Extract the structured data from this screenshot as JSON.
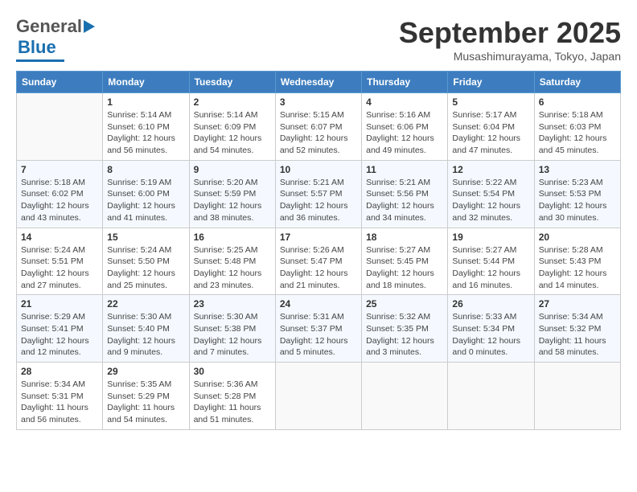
{
  "header": {
    "logo_general": "General",
    "logo_blue": "Blue",
    "month_title": "September 2025",
    "location": "Musashimurayama, Tokyo, Japan"
  },
  "weekdays": [
    "Sunday",
    "Monday",
    "Tuesday",
    "Wednesday",
    "Thursday",
    "Friday",
    "Saturday"
  ],
  "weeks": [
    [
      {
        "day": "",
        "info": ""
      },
      {
        "day": "1",
        "info": "Sunrise: 5:14 AM\nSunset: 6:10 PM\nDaylight: 12 hours\nand 56 minutes."
      },
      {
        "day": "2",
        "info": "Sunrise: 5:14 AM\nSunset: 6:09 PM\nDaylight: 12 hours\nand 54 minutes."
      },
      {
        "day": "3",
        "info": "Sunrise: 5:15 AM\nSunset: 6:07 PM\nDaylight: 12 hours\nand 52 minutes."
      },
      {
        "day": "4",
        "info": "Sunrise: 5:16 AM\nSunset: 6:06 PM\nDaylight: 12 hours\nand 49 minutes."
      },
      {
        "day": "5",
        "info": "Sunrise: 5:17 AM\nSunset: 6:04 PM\nDaylight: 12 hours\nand 47 minutes."
      },
      {
        "day": "6",
        "info": "Sunrise: 5:18 AM\nSunset: 6:03 PM\nDaylight: 12 hours\nand 45 minutes."
      }
    ],
    [
      {
        "day": "7",
        "info": "Sunrise: 5:18 AM\nSunset: 6:02 PM\nDaylight: 12 hours\nand 43 minutes."
      },
      {
        "day": "8",
        "info": "Sunrise: 5:19 AM\nSunset: 6:00 PM\nDaylight: 12 hours\nand 41 minutes."
      },
      {
        "day": "9",
        "info": "Sunrise: 5:20 AM\nSunset: 5:59 PM\nDaylight: 12 hours\nand 38 minutes."
      },
      {
        "day": "10",
        "info": "Sunrise: 5:21 AM\nSunset: 5:57 PM\nDaylight: 12 hours\nand 36 minutes."
      },
      {
        "day": "11",
        "info": "Sunrise: 5:21 AM\nSunset: 5:56 PM\nDaylight: 12 hours\nand 34 minutes."
      },
      {
        "day": "12",
        "info": "Sunrise: 5:22 AM\nSunset: 5:54 PM\nDaylight: 12 hours\nand 32 minutes."
      },
      {
        "day": "13",
        "info": "Sunrise: 5:23 AM\nSunset: 5:53 PM\nDaylight: 12 hours\nand 30 minutes."
      }
    ],
    [
      {
        "day": "14",
        "info": "Sunrise: 5:24 AM\nSunset: 5:51 PM\nDaylight: 12 hours\nand 27 minutes."
      },
      {
        "day": "15",
        "info": "Sunrise: 5:24 AM\nSunset: 5:50 PM\nDaylight: 12 hours\nand 25 minutes."
      },
      {
        "day": "16",
        "info": "Sunrise: 5:25 AM\nSunset: 5:48 PM\nDaylight: 12 hours\nand 23 minutes."
      },
      {
        "day": "17",
        "info": "Sunrise: 5:26 AM\nSunset: 5:47 PM\nDaylight: 12 hours\nand 21 minutes."
      },
      {
        "day": "18",
        "info": "Sunrise: 5:27 AM\nSunset: 5:45 PM\nDaylight: 12 hours\nand 18 minutes."
      },
      {
        "day": "19",
        "info": "Sunrise: 5:27 AM\nSunset: 5:44 PM\nDaylight: 12 hours\nand 16 minutes."
      },
      {
        "day": "20",
        "info": "Sunrise: 5:28 AM\nSunset: 5:43 PM\nDaylight: 12 hours\nand 14 minutes."
      }
    ],
    [
      {
        "day": "21",
        "info": "Sunrise: 5:29 AM\nSunset: 5:41 PM\nDaylight: 12 hours\nand 12 minutes."
      },
      {
        "day": "22",
        "info": "Sunrise: 5:30 AM\nSunset: 5:40 PM\nDaylight: 12 hours\nand 9 minutes."
      },
      {
        "day": "23",
        "info": "Sunrise: 5:30 AM\nSunset: 5:38 PM\nDaylight: 12 hours\nand 7 minutes."
      },
      {
        "day": "24",
        "info": "Sunrise: 5:31 AM\nSunset: 5:37 PM\nDaylight: 12 hours\nand 5 minutes."
      },
      {
        "day": "25",
        "info": "Sunrise: 5:32 AM\nSunset: 5:35 PM\nDaylight: 12 hours\nand 3 minutes."
      },
      {
        "day": "26",
        "info": "Sunrise: 5:33 AM\nSunset: 5:34 PM\nDaylight: 12 hours\nand 0 minutes."
      },
      {
        "day": "27",
        "info": "Sunrise: 5:34 AM\nSunset: 5:32 PM\nDaylight: 11 hours\nand 58 minutes."
      }
    ],
    [
      {
        "day": "28",
        "info": "Sunrise: 5:34 AM\nSunset: 5:31 PM\nDaylight: 11 hours\nand 56 minutes."
      },
      {
        "day": "29",
        "info": "Sunrise: 5:35 AM\nSunset: 5:29 PM\nDaylight: 11 hours\nand 54 minutes."
      },
      {
        "day": "30",
        "info": "Sunrise: 5:36 AM\nSunset: 5:28 PM\nDaylight: 11 hours\nand 51 minutes."
      },
      {
        "day": "",
        "info": ""
      },
      {
        "day": "",
        "info": ""
      },
      {
        "day": "",
        "info": ""
      },
      {
        "day": "",
        "info": ""
      }
    ]
  ]
}
